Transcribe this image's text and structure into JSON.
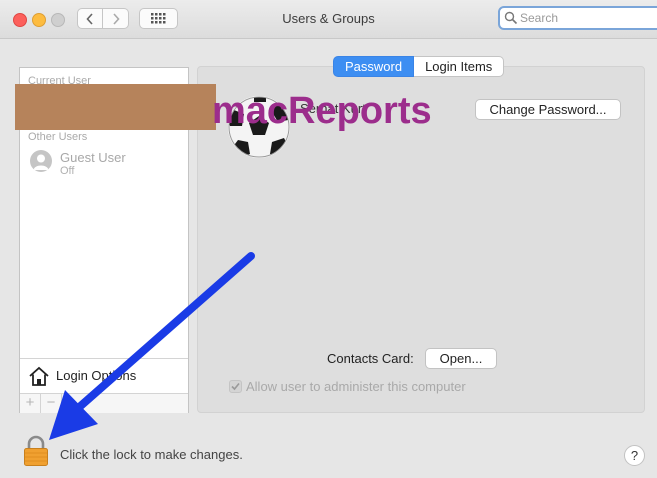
{
  "window": {
    "title": "Users & Groups",
    "search_placeholder": "Search"
  },
  "sidebar": {
    "current_user_label": "Current User",
    "other_users_label": "Other Users",
    "guest": {
      "name": "Guest User",
      "status": "Off"
    },
    "login_options_label": "Login Options",
    "add_symbol": "+",
    "remove_symbol": "−"
  },
  "tabs": [
    {
      "label": "Password",
      "active": true
    },
    {
      "label": "Login Items",
      "active": false
    }
  ],
  "user": {
    "name_partial": "Serhat Kurt"
  },
  "buttons": {
    "change_password": "Change Password...",
    "open": "Open..."
  },
  "contacts_card_label": "Contacts Card:",
  "admin_checkbox": {
    "label": "Allow user to administer this computer",
    "checked": true
  },
  "lock_text": "Click the lock to make changes.",
  "help_label": "?",
  "watermark": "macReports",
  "colors": {
    "accent": "#3d8ef2",
    "arrow": "#1a3be6",
    "redaction": "#b6835b",
    "watermark": "#9c2d8c",
    "lock": "#f0a030"
  }
}
